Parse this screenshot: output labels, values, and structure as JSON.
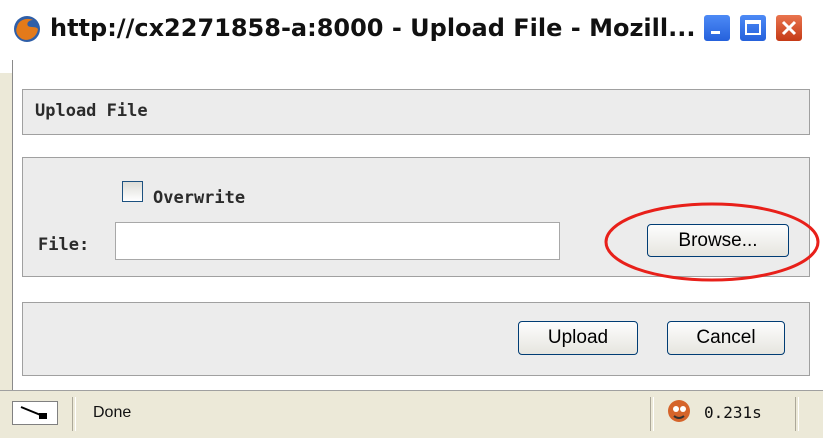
{
  "window": {
    "title": "http://cx2271858-a:8000 - Upload File - Mozill...",
    "controls": {
      "minimize": "minimize",
      "maximize": "maximize",
      "close": "close"
    }
  },
  "header": {
    "title": "Upload File"
  },
  "form": {
    "overwrite_label": "Overwrite",
    "overwrite_checked": false,
    "file_label": "File:",
    "file_value": "",
    "browse_label": "Browse..."
  },
  "actions": {
    "upload_label": "Upload",
    "cancel_label": "Cancel"
  },
  "statusbar": {
    "status_text": "Done",
    "timer_text": "0.231s"
  },
  "colors": {
    "annotation": "#e8201a",
    "panel_bg": "#ececec",
    "button_border": "#003c74"
  }
}
